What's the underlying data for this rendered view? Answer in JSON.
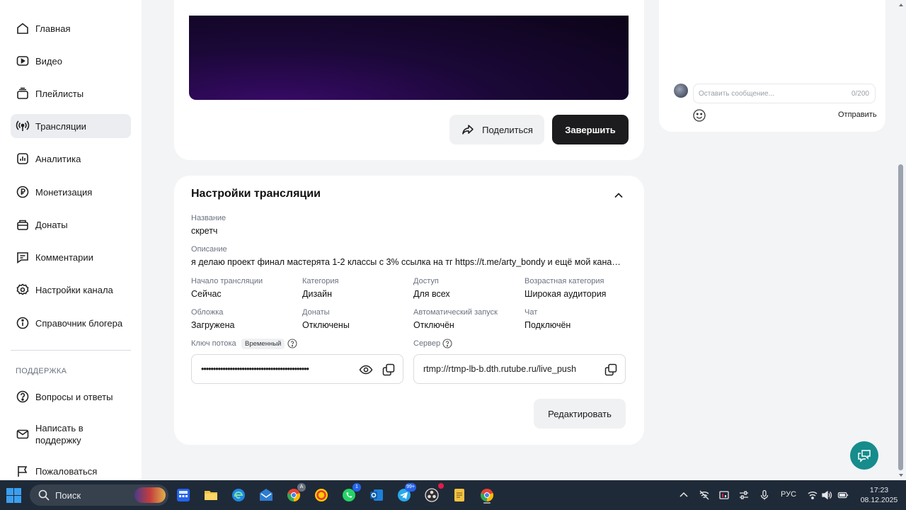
{
  "sidebar": {
    "items": [
      {
        "label": "Главная",
        "icon": "home-icon"
      },
      {
        "label": "Видео",
        "icon": "video-icon"
      },
      {
        "label": "Плейлисты",
        "icon": "playlist-icon"
      },
      {
        "label": "Трансляции",
        "icon": "broadcast-icon",
        "active": true
      },
      {
        "label": "Аналитика",
        "icon": "analytics-icon"
      },
      {
        "label": "Монетизация",
        "icon": "ruble-icon"
      },
      {
        "label": "Донаты",
        "icon": "donate-icon"
      },
      {
        "label": "Комментарии",
        "icon": "comment-icon"
      },
      {
        "label": "Настройки канала",
        "icon": "gear-icon"
      },
      {
        "label": "Справочник блогера",
        "icon": "info-icon"
      }
    ],
    "support_title": "ПОДДЕРЖКА",
    "support_items": [
      {
        "label": "Вопросы и ответы",
        "icon": "question-icon"
      },
      {
        "label": "Написать в поддержку",
        "icon": "mail-icon"
      },
      {
        "label": "Пожаловаться",
        "icon": "flag-icon"
      }
    ]
  },
  "player": {
    "share_label": "Поделиться",
    "finish_label": "Завершить"
  },
  "settings": {
    "title": "Настройки трансляции",
    "name_label": "Название",
    "name_value": "скретч",
    "description_label": "Описание",
    "description_value": "я делаю проект финал мастерята 1-2 классы с 3% ссылка на тг https://t.me/arty_bondy и ещё мой канал т...",
    "fields": [
      {
        "label": "Начало трансляции",
        "value": "Сейчас"
      },
      {
        "label": "Категория",
        "value": "Дизайн"
      },
      {
        "label": "Доступ",
        "value": "Для всех"
      },
      {
        "label": "Возрастная категория",
        "value": "Широкая аудитория"
      },
      {
        "label": "Обложка",
        "value": "Загружена"
      },
      {
        "label": "Донаты",
        "value": "Отключены"
      },
      {
        "label": "Автоматический запуск",
        "value": "Отключён"
      },
      {
        "label": "Чат",
        "value": "Подключён"
      }
    ],
    "stream_key_label": "Ключ потока",
    "stream_key_badge": "Временный",
    "stream_key_value": "•••••••••••••••••••••••••••••••••••••••••••••",
    "server_label": "Сервер",
    "server_value": "rtmp://rtmp-lb-b.dth.rutube.ru/live_push",
    "edit_label": "Редактировать"
  },
  "chat": {
    "placeholder": "Оставить сообщение...",
    "counter": "0/200",
    "send_label": "Отправить"
  },
  "taskbar": {
    "search_label": "Поиск",
    "language": "РУС",
    "time": "17:23",
    "date": "08.12.2025",
    "badges": {
      "chrome": "A",
      "whatsapp": "1",
      "telegram": "99+"
    }
  },
  "colors": {
    "accent_dark": "#1c1c1e",
    "help_fab": "#168c8c",
    "taskbar": "#1f2a38"
  }
}
